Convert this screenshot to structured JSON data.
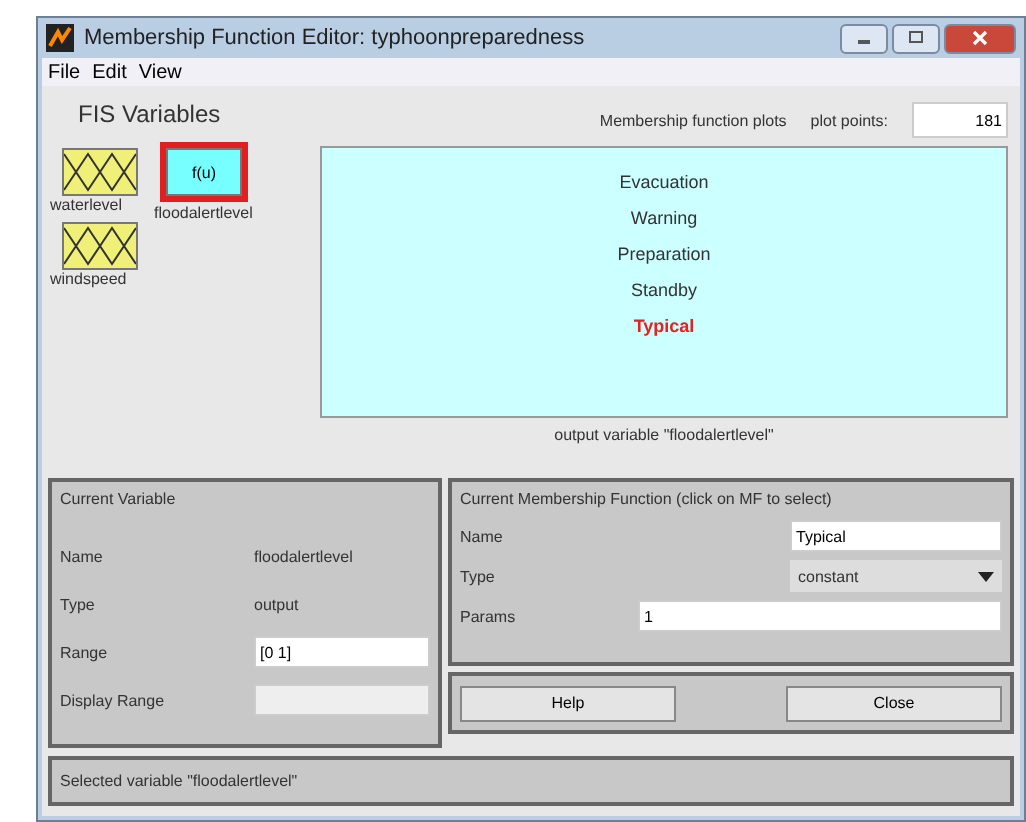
{
  "window": {
    "title": "Membership Function Editor: typhoonpreparedness"
  },
  "menu": [
    "File",
    "Edit",
    "View"
  ],
  "fis_variables": {
    "title": "FIS Variables",
    "variables": [
      {
        "kind": "input",
        "label": "waterlevel",
        "selected": false
      },
      {
        "kind": "output",
        "label": "floodalertlevel",
        "icon_text": "f(u)",
        "selected": true
      },
      {
        "kind": "input",
        "label": "windspeed",
        "selected": false
      }
    ]
  },
  "plot": {
    "title": "Membership function plots",
    "plot_points_label": "plot points:",
    "plot_points": "181",
    "membership_functions": [
      {
        "name": "Evacuation",
        "selected": false
      },
      {
        "name": "Warning",
        "selected": false
      },
      {
        "name": "Preparation",
        "selected": false
      },
      {
        "name": "Standby",
        "selected": false
      },
      {
        "name": "Typical",
        "selected": true
      }
    ],
    "caption": "output variable \"floodalertlevel\""
  },
  "current_variable": {
    "title": "Current Variable",
    "name_label": "Name",
    "name": "floodalertlevel",
    "type_label": "Type",
    "type": "output",
    "range_label": "Range",
    "range": "[0 1]",
    "display_range_label": "Display Range"
  },
  "current_mf": {
    "title": "Current Membership Function (click on MF to select)",
    "name_label": "Name",
    "name": "Typical",
    "type_label": "Type",
    "type": "constant",
    "params_label": "Params",
    "params": "1"
  },
  "buttons": [
    "Help",
    "Close"
  ],
  "status": "Selected variable \"floodalertlevel\""
}
